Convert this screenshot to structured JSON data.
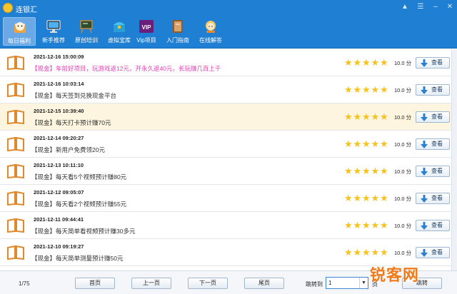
{
  "window": {
    "title": "连银汇"
  },
  "toolbar": {
    "items": [
      {
        "label": "每日福利",
        "icon": "cat-gift-icon"
      },
      {
        "label": "新手推荐",
        "icon": "monitor-icon"
      },
      {
        "label": "原创培训",
        "icon": "easel-board-icon"
      },
      {
        "label": "虚拟宝库",
        "icon": "treasure-box-icon"
      },
      {
        "label": "Vip项目",
        "icon": "vip-badge-icon",
        "badge": "VIP"
      },
      {
        "label": "入门指南",
        "icon": "guide-book-icon"
      },
      {
        "label": "在线解答",
        "icon": "support-avatar-icon"
      }
    ]
  },
  "list": {
    "rows": [
      {
        "date": "2021-12-16 15:00:09",
        "title": "【现金】年前好项目，玩游戏返12元，开永久返40元，长玩赚几百上千",
        "score": "10.0 分",
        "view": "查看",
        "highlight": false,
        "pink": true
      },
      {
        "date": "2021-12-16 10:03:14",
        "title": "【现金】每天签到兑换现金平台",
        "score": "10.0 分",
        "view": "查看",
        "highlight": false,
        "pink": false
      },
      {
        "date": "2021-12-15 10:39:40",
        "title": "【现金】每天打卡预计赚70元",
        "score": "10.0 分",
        "view": "查看",
        "highlight": true,
        "pink": false
      },
      {
        "date": "2021-12-14 09:20:27",
        "title": "【现金】新用户免费领20元",
        "score": "10.0 分",
        "view": "查看",
        "highlight": false,
        "pink": false
      },
      {
        "date": "2021-12-13 10:11:10",
        "title": "【现金】每天看5个视频预计赚80元",
        "score": "10.0 分",
        "view": "查看",
        "highlight": false,
        "pink": false
      },
      {
        "date": "2021-12-12 09:05:07",
        "title": "【现金】每天看2个视频预计赚55元",
        "score": "10.0 分",
        "view": "查看",
        "highlight": false,
        "pink": false
      },
      {
        "date": "2021-12-11 09:44:41",
        "title": "【现金】每天简单看视频预计赚30多元",
        "score": "10.0 分",
        "view": "查看",
        "highlight": false,
        "pink": false
      },
      {
        "date": "2021-12-10 09:19:27",
        "title": "【现金】每天简单测量预计赚50元",
        "score": "10.0 分",
        "view": "查看",
        "highlight": false,
        "pink": false
      }
    ]
  },
  "footer": {
    "page_info": "1/75",
    "first": "首页",
    "prev": "上一页",
    "next": "下一页",
    "last": "尾页",
    "jump_label": "跳转到",
    "jump_value": "1",
    "page_unit": "页",
    "jump_button": "跳转"
  },
  "watermark": "锐客网",
  "colors": {
    "titlebar": "#1f7fd3",
    "star": "#f6c21b",
    "pink_title": "#e43fb3",
    "highlight_row": "#fdf5df"
  }
}
